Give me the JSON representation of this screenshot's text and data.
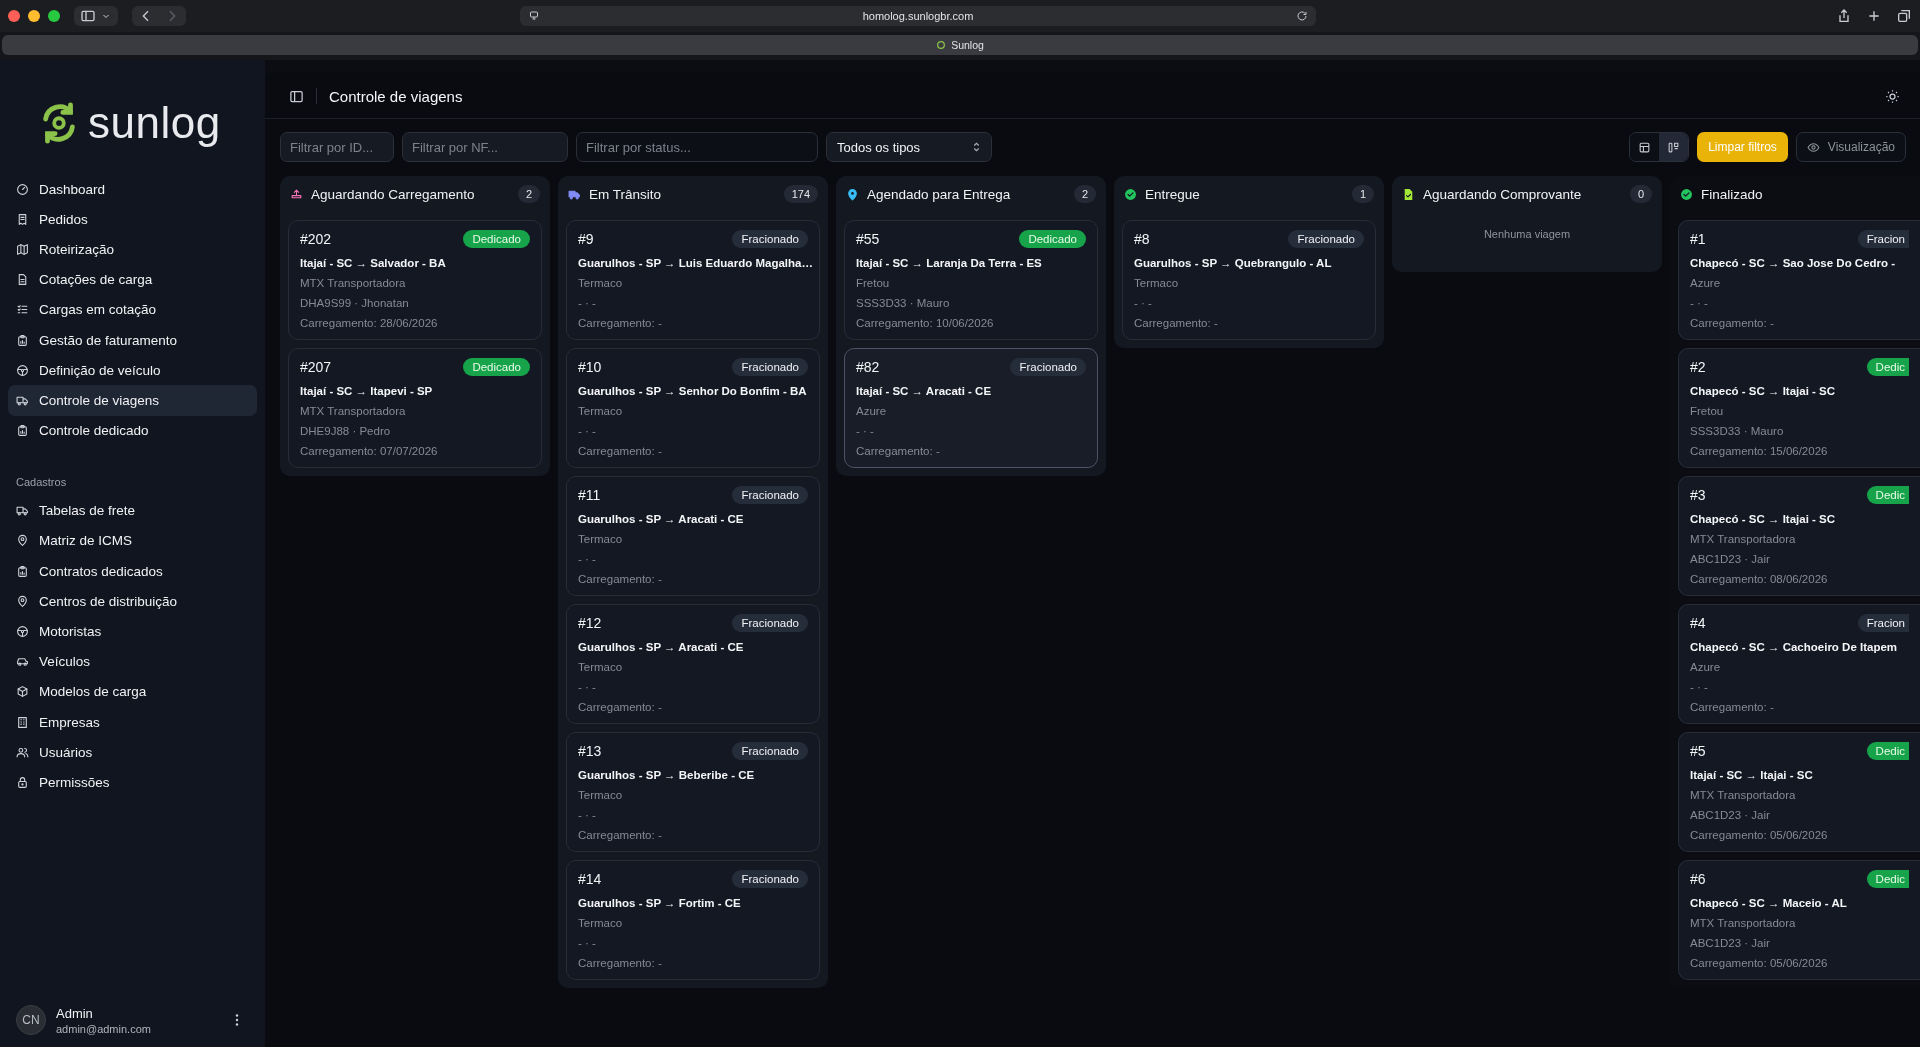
{
  "browser": {
    "url": "homolog.sunlogbr.com",
    "tab_title": "Sunlog"
  },
  "sidebar": {
    "logo": "sunlog",
    "items": [
      {
        "label": "Dashboard",
        "selected": false
      },
      {
        "label": "Pedidos",
        "selected": false
      },
      {
        "label": "Roteirização",
        "selected": false
      },
      {
        "label": "Cotações de carga",
        "selected": false
      },
      {
        "label": "Cargas em cotação",
        "selected": false
      },
      {
        "label": "Gestão de faturamento",
        "selected": false
      },
      {
        "label": "Definição de veículo",
        "selected": false
      },
      {
        "label": "Controle de viagens",
        "selected": true
      },
      {
        "label": "Controle dedicado",
        "selected": false
      }
    ],
    "section_title": "Cadastros",
    "section_items": [
      {
        "label": "Tabelas de frete",
        "selected": false
      },
      {
        "label": "Matriz de ICMS",
        "selected": false
      },
      {
        "label": "Contratos dedicados",
        "selected": false
      },
      {
        "label": "Centros de distribuição",
        "selected": false
      },
      {
        "label": "Motoristas",
        "selected": false
      },
      {
        "label": "Veículos",
        "selected": false
      },
      {
        "label": "Modelos de carga",
        "selected": false
      },
      {
        "label": "Empresas",
        "selected": false
      },
      {
        "label": "Usuários",
        "selected": false
      },
      {
        "label": "Permissões",
        "selected": false
      }
    ],
    "user": {
      "initials": "CN",
      "name": "Admin",
      "email": "admin@admin.com"
    }
  },
  "header": {
    "title": "Controle de viagens"
  },
  "filters": {
    "id_placeholder": "Filtrar por ID...",
    "nf_placeholder": "Filtrar por NF...",
    "status_placeholder": "Filtrar por status...",
    "type_select": "Todos os tipos",
    "views": [
      {
        "kind": "table",
        "selected": false
      },
      {
        "kind": "board",
        "selected": true
      }
    ],
    "clear_button": "Limpar filtros",
    "view_button": "Visualização"
  },
  "columns": [
    {
      "title": "Aguardando Carregamento",
      "count": "2",
      "color": "#f472b6",
      "cards": [
        {
          "id": "#202",
          "kind": "dedicado",
          "badge": "Dedicado",
          "route": "Itajaí - SC → Salvador - BA",
          "carrier": "MTX Transportadora",
          "vehicle": "DHA9S99 · Jhonatan",
          "loading": "Carregamento: 28/06/2026",
          "selected": false
        },
        {
          "id": "#207",
          "kind": "dedicado",
          "badge": "Dedicado",
          "route": "Itajaí - SC → Itapevi - SP",
          "carrier": "MTX Transportadora",
          "vehicle": "DHE9J88 · Pedro",
          "loading": "Carregamento: 07/07/2026",
          "selected": false
        }
      ]
    },
    {
      "title": "Em Trânsito",
      "count": "174",
      "color": "#818cf8",
      "cards": [
        {
          "id": "#9",
          "kind": "fracionado",
          "badge": "Fracionado",
          "route": "Guarulhos - SP → Luis Eduardo Magalha…",
          "carrier": "Termaco",
          "vehicle": "- · -",
          "loading": "Carregamento: -",
          "selected": false
        },
        {
          "id": "#10",
          "kind": "fracionado",
          "badge": "Fracionado",
          "route": "Guarulhos - SP → Senhor Do Bonfim - BA",
          "carrier": "Termaco",
          "vehicle": "- · -",
          "loading": "Carregamento: -",
          "selected": false
        },
        {
          "id": "#11",
          "kind": "fracionado",
          "badge": "Fracionado",
          "route": "Guarulhos - SP → Aracati - CE",
          "carrier": "Termaco",
          "vehicle": "- · -",
          "loading": "Carregamento: -",
          "selected": false
        },
        {
          "id": "#12",
          "kind": "fracionado",
          "badge": "Fracionado",
          "route": "Guarulhos - SP → Aracati - CE",
          "carrier": "Termaco",
          "vehicle": "- · -",
          "loading": "Carregamento: -",
          "selected": false
        },
        {
          "id": "#13",
          "kind": "fracionado",
          "badge": "Fracionado",
          "route": "Guarulhos - SP → Beberibe - CE",
          "carrier": "Termaco",
          "vehicle": "- · -",
          "loading": "Carregamento: -",
          "selected": false
        },
        {
          "id": "#14",
          "kind": "fracionado",
          "badge": "Fracionado",
          "route": "Guarulhos - SP → Fortim - CE",
          "carrier": "Termaco",
          "vehicle": "- · -",
          "loading": "Carregamento: -",
          "selected": false
        }
      ]
    },
    {
      "title": "Agendado para Entrega",
      "count": "2",
      "color": "#38bdf8",
      "cards": [
        {
          "id": "#55",
          "kind": "dedicado",
          "badge": "Dedicado",
          "route": "Itajaí - SC → Laranja Da Terra - ES",
          "carrier": "Fretou",
          "vehicle": "SSS3D33 · Mauro",
          "loading": "Carregamento: 10/06/2026",
          "selected": false
        },
        {
          "id": "#82",
          "kind": "fracionado",
          "badge": "Fracionado",
          "route": "Itajaí - SC → Aracati - CE",
          "carrier": "Azure",
          "vehicle": "- · -",
          "loading": "Carregamento: -",
          "selected": true
        }
      ]
    },
    {
      "title": "Entregue",
      "count": "1",
      "color": "#22c55e",
      "cards": [
        {
          "id": "#8",
          "kind": "fracionado",
          "badge": "Fracionado",
          "route": "Guarulhos - SP → Quebrangulo - AL",
          "carrier": "Termaco",
          "vehicle": "- · -",
          "loading": "Carregamento: -",
          "selected": false
        }
      ]
    },
    {
      "title": "Aguardando Comprovante",
      "count": "0",
      "color": "#a3e635",
      "empty_text": "Nenhuma viagem"
    },
    {
      "title": "Finalizado",
      "color": "#22c55e",
      "cards": [
        {
          "id": "#1",
          "kind": "fracionado",
          "badge": "Fracion",
          "route": "Chapecó - SC → Sao Jose Do Cedro -",
          "carrier": "Azure",
          "vehicle": "- · -",
          "loading": "Carregamento: -",
          "selected": false
        },
        {
          "id": "#2",
          "kind": "dedicado",
          "badge": "Dedic",
          "route": "Chapecó - SC → Itajai - SC",
          "carrier": "Fretou",
          "vehicle": "SSS3D33 · Mauro",
          "loading": "Carregamento: 15/06/2026",
          "selected": false
        },
        {
          "id": "#3",
          "kind": "dedicado",
          "badge": "Dedic",
          "route": "Chapecó - SC → Itajai - SC",
          "carrier": "MTX Transportadora",
          "vehicle": "ABC1D23 · Jair",
          "loading": "Carregamento: 08/06/2026",
          "selected": false
        },
        {
          "id": "#4",
          "kind": "fracionado",
          "badge": "Fracion",
          "route": "Chapecó - SC → Cachoeiro De Itapem",
          "carrier": "Azure",
          "vehicle": "- · -",
          "loading": "Carregamento: -",
          "selected": false
        },
        {
          "id": "#5",
          "kind": "dedicado",
          "badge": "Dedic",
          "route": "Itajaí - SC → Itajai - SC",
          "carrier": "MTX Transportadora",
          "vehicle": "ABC1D23 · Jair",
          "loading": "Carregamento: 05/06/2026",
          "selected": false
        },
        {
          "id": "#6",
          "kind": "dedicado",
          "badge": "Dedic",
          "route": "Chapecó - SC → Maceio - AL",
          "carrier": "MTX Transportadora",
          "vehicle": "ABC1D23 · Jair",
          "loading": "Carregamento: 05/06/2026",
          "selected": false
        }
      ]
    }
  ]
}
